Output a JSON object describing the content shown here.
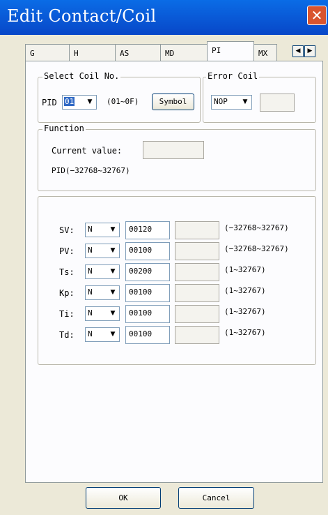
{
  "window": {
    "title": "Edit Contact/Coil",
    "close_glyph": "✕"
  },
  "tabs": [
    "G",
    "H",
    "AS",
    "MD",
    "PI",
    "MX"
  ],
  "active_tab": "PI",
  "tab_scroll": {
    "left": "◀",
    "right": "▶"
  },
  "select_coil": {
    "title": "Select Coil No.",
    "prefix": "PID",
    "value": "01",
    "range": "(01~0F)",
    "symbol_button": "Symbol"
  },
  "error_coil": {
    "title": "Error Coil",
    "value": "NOP",
    "field": ""
  },
  "function": {
    "title": "Function",
    "current_label": "Current value:",
    "current_value": "",
    "range": "PID(−32768~32767)"
  },
  "params": [
    {
      "label": "SV:",
      "type": "N",
      "value": "00120",
      "extra": "",
      "range": "(−32768~32767)"
    },
    {
      "label": "PV:",
      "type": "N",
      "value": "00100",
      "extra": "",
      "range": "(−32768~32767)"
    },
    {
      "label": "Ts:",
      "type": "N",
      "value": "00200",
      "extra": "",
      "range": "(1~32767)"
    },
    {
      "label": "Kp:",
      "type": "N",
      "value": "00100",
      "extra": "",
      "range": "(1~32767)"
    },
    {
      "label": "Ti:",
      "type": "N",
      "value": "00100",
      "extra": "",
      "range": "(1~32767)"
    },
    {
      "label": "Td:",
      "type": "N",
      "value": "00100",
      "extra": "",
      "range": "(1~32767)"
    }
  ],
  "buttons": {
    "ok": "OK",
    "cancel": "Cancel"
  },
  "icons": {
    "close": "close-icon",
    "dropdown": "chevron-down-icon",
    "scroll_left": "arrow-left-icon",
    "scroll_right": "arrow-right-icon"
  },
  "colors": {
    "titlebar": "#0847c8",
    "close": "#d9542e",
    "selection": "#316ac5"
  }
}
